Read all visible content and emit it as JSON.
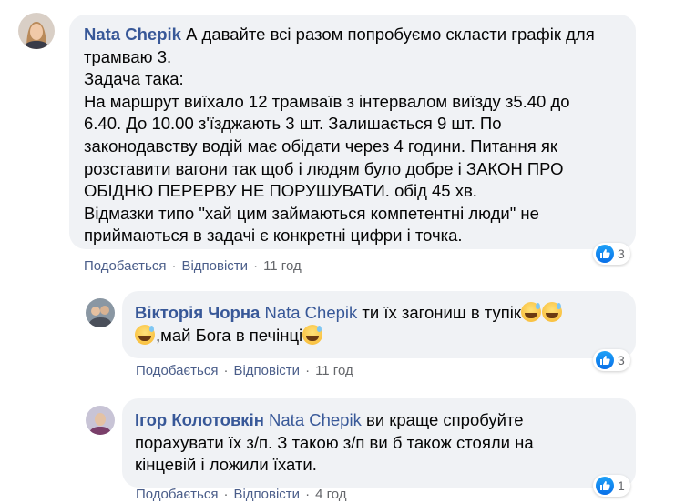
{
  "colors": {
    "author": "#385898",
    "bubble": "#f0f2f5",
    "meta": "#65676b",
    "like_blue": "#1877f2"
  },
  "actions": {
    "like_label": "Подобається",
    "reply_label": "Відповісти",
    "separator": "·"
  },
  "comments": [
    {
      "author": "Nata Chepik",
      "lines": [
        "А давайте всі разом попробуємо скласти графік для",
        "трамваю 3.",
        "Задача така:",
        "На маршрут виїхало 12 трамваїв з інтервалом виїзду з5.40 до",
        "6.40. До 10.00 з'їзджають 3 шт. Залишається 9 шт. По",
        "законодавству водій має обідати через 4 години. Питання як",
        "розставити вагони так щоб і людям було добре і ЗАКОН ПРО",
        "ОБІДНЮ ПЕРЕРВУ НЕ ПОРУШУВАТИ. обід 45 хв.",
        "Відмазки типо \"хай цим займаються компетентні люди\" не",
        "приймаються в задачі є конкретні цифри і точка."
      ],
      "time": "11 год",
      "reaction_count": "3",
      "reaction_icon": "like-icon"
    },
    {
      "author": "Вікторія Чорна",
      "mention": "Nata Chepik",
      "line1": "ти їх загониш в тупік",
      "line2": ",май Бога в печінці",
      "emoji_icon": "grinning-sweat-emoji",
      "time": "11 год",
      "reaction_count": "3",
      "reaction_icon": "like-icon"
    },
    {
      "author": "Ігор Колотовкін",
      "mention": "Nata Chepik",
      "line1": "ви краще спробуйте",
      "line2": "порахувати їх з/п. З такою з/п ви б також стояли на",
      "line3": "кінцевій і ложили їхати.",
      "time": "4 год",
      "reaction_count": "1",
      "reaction_icon": "like-icon"
    }
  ]
}
